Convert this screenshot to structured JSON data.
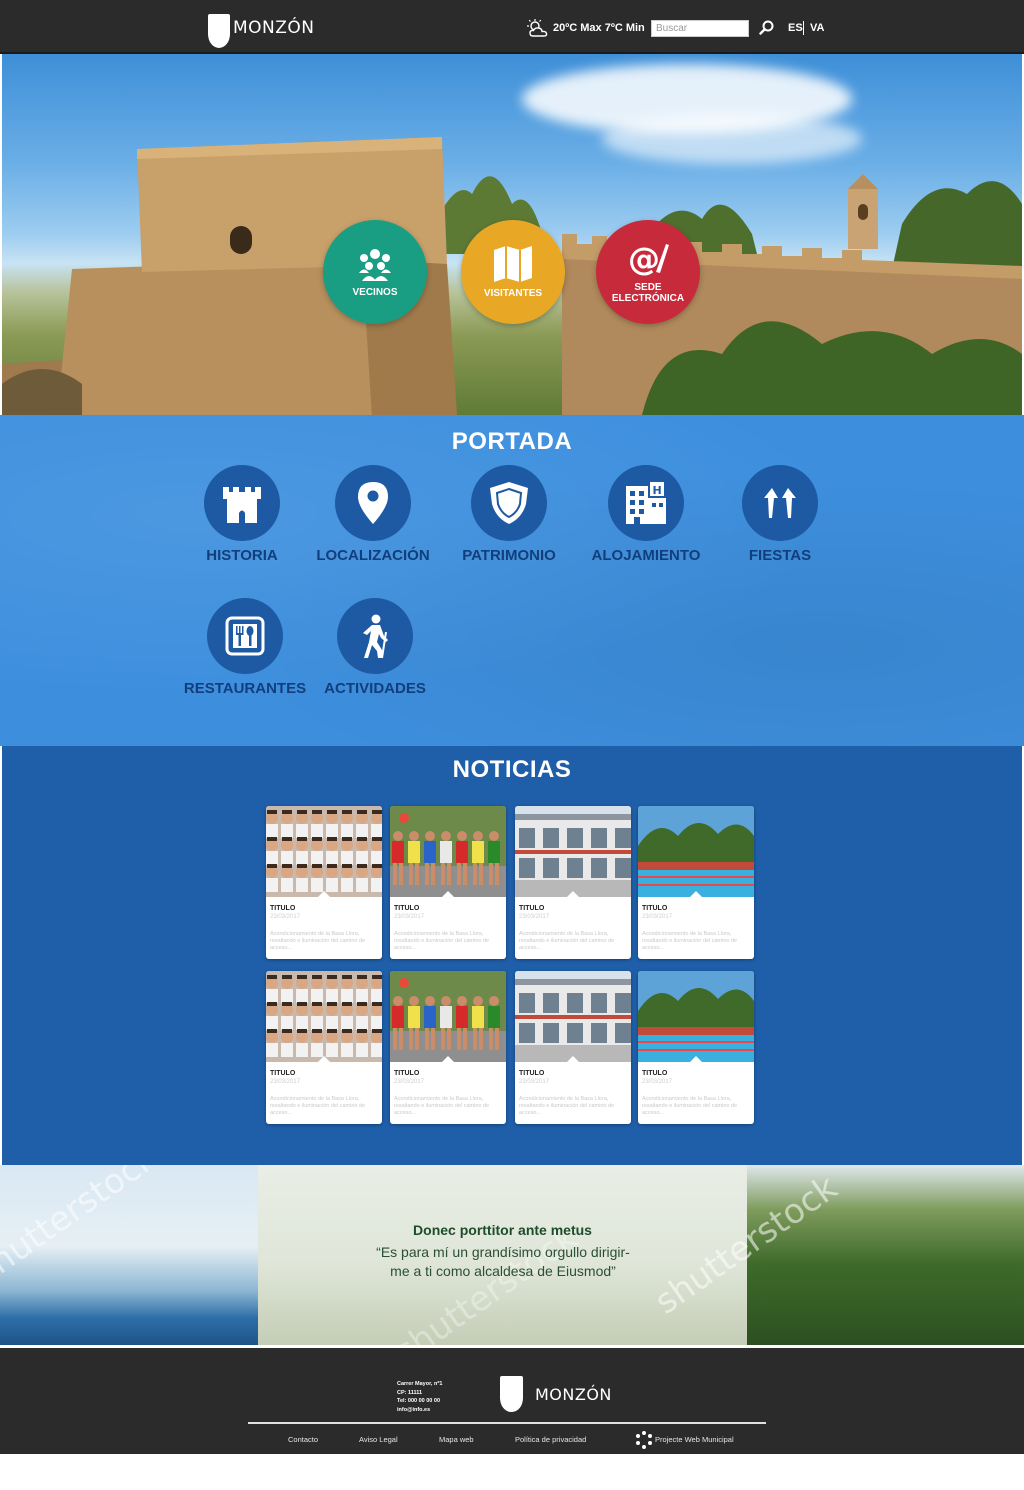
{
  "header": {
    "brand": "MONZÓN",
    "weather_text": "20ºC Max 7ºC Min",
    "search_placeholder": "Buscar",
    "lang_es": "ES",
    "lang_va": "VA"
  },
  "hero": {
    "buttons": [
      {
        "label": "VECINOS",
        "color": "#1a9e83",
        "icon": "people-icon"
      },
      {
        "label": "VISITANTES",
        "color": "#e8a826",
        "icon": "map-icon"
      },
      {
        "label": "SEDE ELECTRÓNICA",
        "color": "#c72a3a",
        "icon": "at-pen-icon"
      }
    ]
  },
  "portada": {
    "title": "PORTADA",
    "items": [
      {
        "label": "HISTORIA",
        "icon": "castle-icon"
      },
      {
        "label": "LOCALIZACIÓN",
        "icon": "location-pin-icon"
      },
      {
        "label": "PATRIMONIO",
        "icon": "shield-icon"
      },
      {
        "label": "ALOJAMIENTO",
        "icon": "hotel-icon"
      },
      {
        "label": "FIESTAS",
        "icon": "party-arrows-icon"
      },
      {
        "label": "RESTAURANTES",
        "icon": "restaurant-icon"
      },
      {
        "label": "ACTIVIDADES",
        "icon": "hiker-icon"
      }
    ]
  },
  "noticias": {
    "title": "NOTICIAS",
    "cards": [
      {
        "title": "TITULO",
        "date": "23/03/2017",
        "text": "Acondicionamiento de la Basa Llora, resaltando e iluminación del camino de acceso...",
        "image": "crowd"
      },
      {
        "title": "TITULO",
        "date": "23/03/2017",
        "text": "Acondicionamiento de la Basa Llora, resaltando e iluminación del camino de acceso...",
        "image": "runners"
      },
      {
        "title": "TITULO",
        "date": "23/03/2017",
        "text": "Acondicionamiento de la Basa Llora, resaltando e iluminación del camino de acceso...",
        "image": "building"
      },
      {
        "title": "TITULO",
        "date": "23/03/2017",
        "text": "Acondicionamiento de la Basa Llora, resaltando e iluminación del camino de acceso...",
        "image": "pool"
      },
      {
        "title": "TITULO",
        "date": "23/03/2017",
        "text": "Acondicionamiento de la Basa Llora, resaltando e iluminación del camino de acceso...",
        "image": "crowd"
      },
      {
        "title": "TITULO",
        "date": "23/03/2017",
        "text": "Acondicionamiento de la Basa Llora, resaltando e iluminación del camino de acceso...",
        "image": "runners"
      },
      {
        "title": "TITULO",
        "date": "23/03/2017",
        "text": "Acondicionamiento de la Basa Llora, resaltando e iluminación del camino de acceso...",
        "image": "building"
      },
      {
        "title": "TITULO",
        "date": "23/03/2017",
        "text": "Acondicionamiento de la Basa Llora, resaltando e iluminación del camino de acceso...",
        "image": "pool"
      }
    ]
  },
  "quote": {
    "heading": "Donec porttitor ante metus",
    "text": "“Es para mí un grandísimo orgullo dirigir-me a ti como alcaldesa de Eiusmod”",
    "watermark": "shutterstock"
  },
  "footer": {
    "address_lines": [
      "Carrer Mayor, nº1",
      "CP: 11111",
      "Tel: 000 00 00 00",
      "info@info.es"
    ],
    "brand": "MONZÓN",
    "links": [
      "Contacto",
      "Aviso Legal",
      "Mapa web",
      "Política de privacidad",
      "Projecte Web Municipal"
    ]
  }
}
